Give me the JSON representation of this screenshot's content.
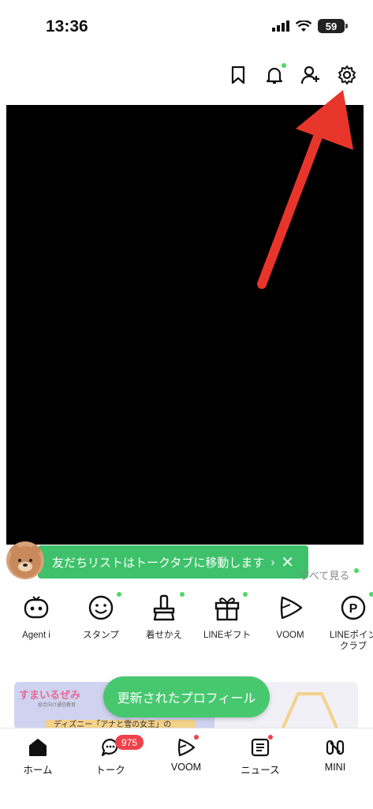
{
  "status": {
    "time": "13:36",
    "battery": "59"
  },
  "toast": {
    "text": "友だちリストはトークタブに移動します",
    "chevron": "›",
    "close": "✕"
  },
  "see_all": "すべて見る",
  "services": [
    {
      "label": "Agent i",
      "icon": "agent-icon",
      "dot": false
    },
    {
      "label": "スタンプ",
      "icon": "sticker-icon",
      "dot": true
    },
    {
      "label": "着せかえ",
      "icon": "theme-icon",
      "dot": true
    },
    {
      "label": "LINEギフト",
      "icon": "gift-icon",
      "dot": true
    },
    {
      "label": "VOOM",
      "icon": "voom-icon",
      "dot": false
    },
    {
      "label": "LINEポイン\nクラブ",
      "icon": "points-icon",
      "dot": true
    }
  ],
  "banner": {
    "logo": "すまいるぜみ",
    "sub": "総合向け通信教育",
    "strip": "ディズニー「アナと雪の女王」の"
  },
  "pill": "更新されたプロフィール",
  "tabs": [
    {
      "label": "ホーム",
      "icon": "home-icon"
    },
    {
      "label": "トーク",
      "icon": "chat-icon",
      "badge": "975"
    },
    {
      "label": "VOOM",
      "icon": "voom-tab-icon"
    },
    {
      "label": "ニュース",
      "icon": "news-icon"
    },
    {
      "label": "MINI",
      "icon": "mini-icon"
    }
  ],
  "colors": {
    "green": "#3ec16a",
    "red": "#f0414b",
    "arrow": "#e8352b"
  }
}
